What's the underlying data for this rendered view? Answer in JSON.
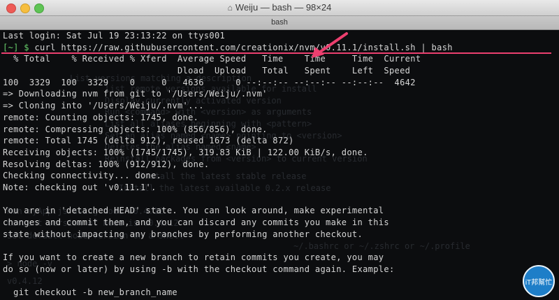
{
  "window": {
    "title": "Weiju — bash — 98×24",
    "tab_label": "bash"
  },
  "terminal": {
    "lines": [
      {
        "text": "Last login: Sat Jul 19 23:13:22 on ttys001"
      },
      {
        "prompt": "[~] $ ",
        "text": "curl https://raw.githubusercontent.com/creationix/nvm/v0.11.1/install.sh | bash"
      },
      {
        "text": "  % Total    % Received % Xferd  Average Speed   Time    Time     Time  Current"
      },
      {
        "text": "                                 Dload  Upload   Total   Spent    Left  Speed"
      },
      {
        "text": "100  3329  100  3329    0     0   4636      0 --:--:-- --:--:-- --:--:--  4642"
      },
      {
        "text": "=> Downloading nvm from git to '/Users/Weiju/.nvm'"
      },
      {
        "text": "=> Cloning into '/Users/Weiju/.nvm'..."
      },
      {
        "text": "remote: Counting objects: 1745, done."
      },
      {
        "text": "remote: Compressing objects: 100% (856/856), done."
      },
      {
        "text": "remote: Total 1745 (delta 912), reused 1673 (delta 872)"
      },
      {
        "text": "Receiving objects: 100% (1745/1745), 319.83 KiB | 122.00 KiB/s, done."
      },
      {
        "text": "Resolving deltas: 100% (912/912), done."
      },
      {
        "text": "Checking connectivity... done."
      },
      {
        "text": "Note: checking out 'v0.11.1'."
      },
      {
        "text": ""
      },
      {
        "text": "You are in 'detached HEAD' state. You can look around, make experimental"
      },
      {
        "text": "changes and commit them, and you can discard any commits you make in this"
      },
      {
        "text": "state without impacting any branches by performing another checkout."
      },
      {
        "text": ""
      },
      {
        "text": "If you want to create a new branch to retain commits you create, you may"
      },
      {
        "text": "do so (now or later) by using -b with the checkout command again. Example:"
      },
      {
        "text": ""
      },
      {
        "text": "  git checkout -b new_branch_name"
      },
      {
        "text": ""
      }
    ],
    "background_ghost_text": [
      "List versions matching a description",
      "list remote versions available for install",
      "Display currently activated version",
      "Run <command> with <version> as arguments",
      "List all aliases beginning with <pattern>",
      "Set an alias named <name> pointing to <version>",
      "Deletes the alias named <name>",
      "Reinstall packages from <version> to current version",
      "Install the latest stable release",
      "Install the latest available 0.2.x release",
      "Run myApp.js using node v0.4.12",
      "Current version of node is v0.4.12",
      "Set default node version on a shell",
      "~/.bashrc or ~/.zshrc or ~/.profile",
      "> node -v",
      "v0.4.12"
    ]
  },
  "badge": {
    "label": "iT邦幫忙"
  },
  "colors": {
    "annotation": "#ec3f6f",
    "prompt_dir": "#68d06c"
  }
}
